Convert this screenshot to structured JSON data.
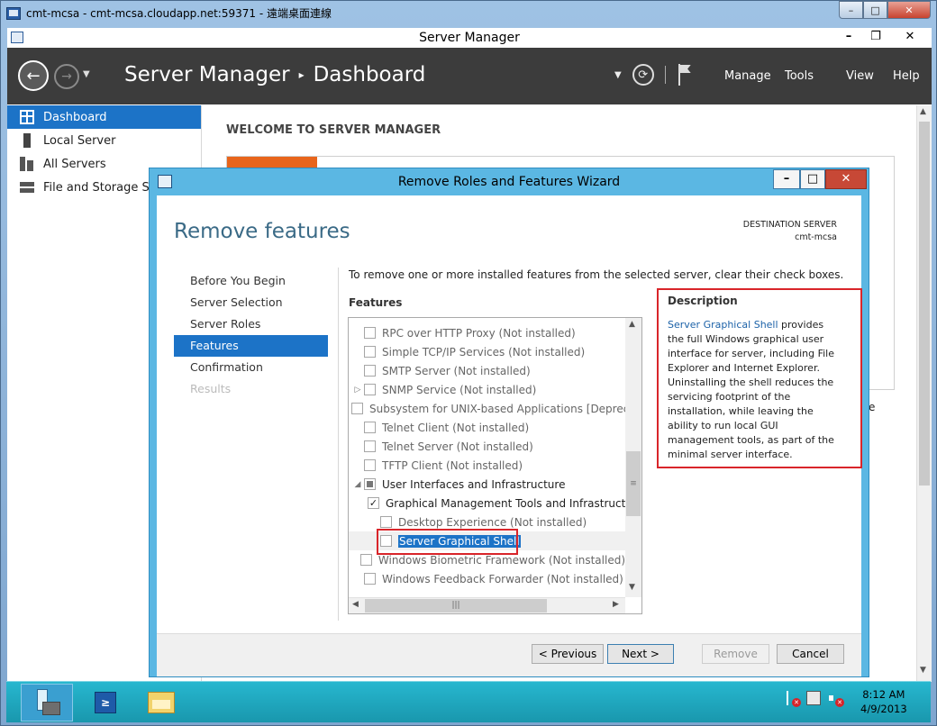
{
  "rdp": {
    "title": "cmt-mcsa - cmt-mcsa.cloudapp.net:59371 - 遠端桌面連線",
    "controls": {
      "minimize": "–",
      "maximize": "□",
      "close": "✕"
    }
  },
  "server_manager": {
    "title": "Server Manager",
    "controls": {
      "minimize": "–",
      "maximize": "❐",
      "close": "✕"
    },
    "breadcrumb": {
      "app": "Server Manager",
      "separator": "▸",
      "page": "Dashboard"
    },
    "menu": [
      "Manage",
      "Tools",
      "View",
      "Help"
    ],
    "sidebar": {
      "items": [
        {
          "label": "Dashboard",
          "icon": "dashboard-icon",
          "active": true
        },
        {
          "label": "Local Server",
          "icon": "server-icon",
          "active": false
        },
        {
          "label": "All Servers",
          "icon": "servers-icon",
          "active": false
        },
        {
          "label": "File and Storage Services",
          "icon": "storage-icon",
          "active": false
        }
      ]
    },
    "main": {
      "welcome_title": "WELCOME TO SERVER MANAGER",
      "clipped_text": "e"
    }
  },
  "wizard": {
    "title": "Remove Roles and Features Wizard",
    "controls": {
      "minimize": "–",
      "maximize": "□",
      "close": "✕"
    },
    "heading": "Remove features",
    "destination": {
      "label": "DESTINATION SERVER",
      "server": "cmt-mcsa"
    },
    "steps": [
      {
        "label": "Before You Begin",
        "state": "normal"
      },
      {
        "label": "Server Selection",
        "state": "normal"
      },
      {
        "label": "Server Roles",
        "state": "normal"
      },
      {
        "label": "Features",
        "state": "active"
      },
      {
        "label": "Confirmation",
        "state": "normal"
      },
      {
        "label": "Results",
        "state": "disabled"
      }
    ],
    "instruction": "To remove one or more installed features from the selected server, clear their check boxes.",
    "features_label": "Features",
    "features": [
      {
        "label": "RPC over HTTP Proxy (Not installed)",
        "indent": 0,
        "expander": "",
        "checkbox": "empty",
        "enabled": false
      },
      {
        "label": "Simple TCP/IP Services (Not installed)",
        "indent": 0,
        "expander": "",
        "checkbox": "empty",
        "enabled": false
      },
      {
        "label": "SMTP Server (Not installed)",
        "indent": 0,
        "expander": "",
        "checkbox": "empty",
        "enabled": false
      },
      {
        "label": "SNMP Service (Not installed)",
        "indent": 0,
        "expander": "▷",
        "checkbox": "empty",
        "enabled": false
      },
      {
        "label": "Subsystem for UNIX-based Applications [Deprecated]",
        "indent": 0,
        "expander": "",
        "checkbox": "empty",
        "enabled": false
      },
      {
        "label": "Telnet Client (Not installed)",
        "indent": 0,
        "expander": "",
        "checkbox": "empty",
        "enabled": false
      },
      {
        "label": "Telnet Server (Not installed)",
        "indent": 0,
        "expander": "",
        "checkbox": "empty",
        "enabled": false
      },
      {
        "label": "TFTP Client (Not installed)",
        "indent": 0,
        "expander": "",
        "checkbox": "empty",
        "enabled": false
      },
      {
        "label": "User Interfaces and Infrastructure",
        "indent": 0,
        "expander": "◢",
        "checkbox": "partial",
        "enabled": true
      },
      {
        "label": "Graphical Management Tools and Infrastructure",
        "indent": 1,
        "expander": "",
        "checkbox": "checked",
        "enabled": true
      },
      {
        "label": "Desktop Experience (Not installed)",
        "indent": 1,
        "expander": "",
        "checkbox": "empty",
        "enabled": false
      },
      {
        "label": "Server Graphical Shell",
        "indent": 1,
        "expander": "",
        "checkbox": "empty",
        "enabled": true,
        "selected": true
      },
      {
        "label": "Windows Biometric Framework (Not installed)",
        "indent": 0,
        "expander": "",
        "checkbox": "empty",
        "enabled": false
      },
      {
        "label": "Windows Feedback Forwarder (Not installed)",
        "indent": 0,
        "expander": "",
        "checkbox": "empty",
        "enabled": false
      }
    ],
    "description": {
      "title": "Description",
      "link": "Server Graphical Shell",
      "text": " provides the full Windows graphical user interface for server, including File Explorer and Internet Explorer. Uninstalling the shell reduces the servicing footprint of the installation, while leaving the ability to run local GUI management tools, as part of the minimal server interface."
    },
    "buttons": {
      "previous": "< Previous",
      "next": "Next >",
      "remove": "Remove",
      "cancel": "Cancel"
    }
  },
  "taskbar": {
    "powershell_glyph": "≥",
    "clock": {
      "time": "8:12 AM",
      "date": "4/9/2013"
    }
  }
}
